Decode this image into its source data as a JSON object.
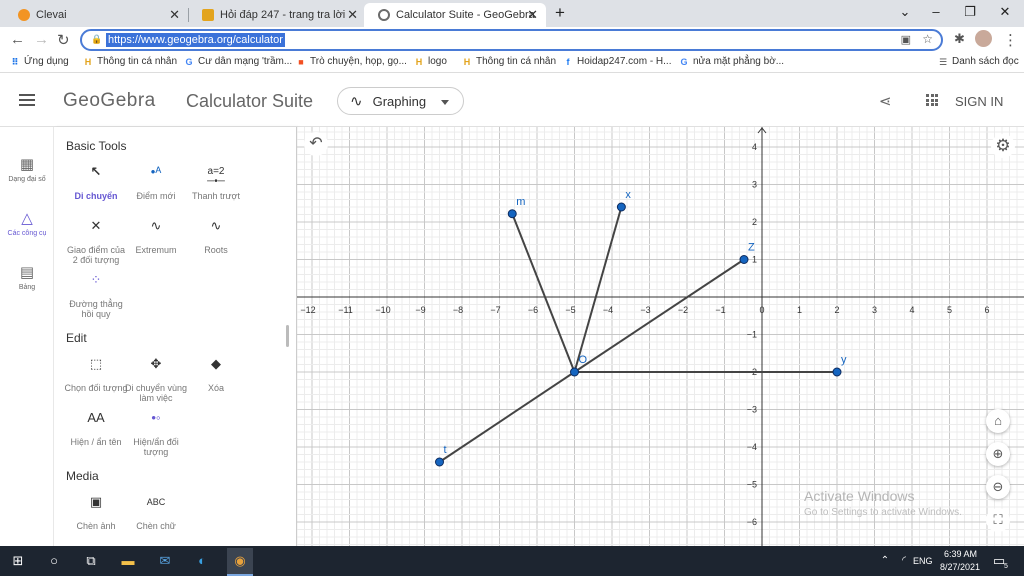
{
  "browser": {
    "tabs": [
      {
        "title": "Clevai",
        "favicon_color": "#f29423"
      },
      {
        "title": "Hỏi đáp 247 - trang tra lời",
        "favicon_color": "#e3a41d"
      },
      {
        "title": "Calculator Suite - GeoGebra",
        "favicon_color": "#6b6b6b"
      }
    ],
    "new_tab": "+",
    "url": "https://www.geogebra.org/calculator",
    "bookmarks": [
      "Ứng dụng",
      "Thông tin cá nhân",
      "Cư dân mạng 'trầm...",
      "Trò chuyện, họp, gọ...",
      "logo",
      "Thông tin cá nhân",
      "Hoidap247.com - H...",
      "nửa mặt phẳng bờ...",
      "Danh sách đọc"
    ]
  },
  "app": {
    "logo": "GeoGebra",
    "suite": "Calculator Suite",
    "app_picker": "Graphing",
    "sign_in": "SIGN IN"
  },
  "rail": [
    {
      "label": "Dạng đại số",
      "icon": "calculator-icon"
    },
    {
      "label": "Các công cụ",
      "icon": "tools-icon"
    },
    {
      "label": "Bảng",
      "icon": "table-icon"
    }
  ],
  "panel": {
    "basic_title": "Basic Tools",
    "basic_tools": [
      {
        "label": "Di chuyển",
        "icon": "move-cursor-icon"
      },
      {
        "label": "Điểm mới",
        "icon": "point-icon"
      },
      {
        "label": "Thanh trượt",
        "icon": "slider-icon"
      },
      {
        "label": "Giao điểm của 2 đối tượng",
        "icon": "intersect-icon"
      },
      {
        "label": "Extremum",
        "icon": "extremum-icon"
      },
      {
        "label": "Roots",
        "icon": "roots-icon"
      },
      {
        "label": "Đường thẳng hồi quy",
        "icon": "regression-icon"
      }
    ],
    "edit_title": "Edit",
    "edit_tools": [
      {
        "label": "Chọn đối tượng",
        "icon": "select-icon"
      },
      {
        "label": "Di chuyển vùng làm việc",
        "icon": "move-view-icon"
      },
      {
        "label": "Xóa",
        "icon": "eraser-icon"
      },
      {
        "label": "Hiện / ẩn tên",
        "icon": "label-toggle-icon"
      },
      {
        "label": "Hiện/ẩn đối tượng",
        "icon": "object-toggle-icon"
      }
    ],
    "media_title": "Media",
    "media_tools": [
      {
        "label": "Chèn ảnh",
        "icon": "image-icon"
      },
      {
        "label": "Chèn chữ",
        "icon": "text-icon"
      }
    ]
  },
  "graph": {
    "x_range": [
      -12.5,
      6.8
    ],
    "y_range": [
      -6.6,
      4.4
    ],
    "x_ticks": [
      -12,
      -11,
      -10,
      -9,
      -8,
      -7,
      -6,
      -5,
      -4,
      -3,
      -2,
      -1,
      0,
      1,
      2,
      3,
      4,
      5,
      6
    ],
    "y_ticks": [
      -6,
      -5,
      -4,
      -3,
      -2,
      -1,
      1,
      2,
      3,
      4
    ],
    "point_color": "#1565c0",
    "line_color": "#444444",
    "points": [
      {
        "name": "O",
        "x": -5.0,
        "y": -2.0
      },
      {
        "name": "m",
        "x": -6.66,
        "y": 2.22
      },
      {
        "name": "x",
        "x": -3.75,
        "y": 2.4
      },
      {
        "name": "Z",
        "x": -0.48,
        "y": 1.0
      },
      {
        "name": "y",
        "x": 2.0,
        "y": -2.0
      },
      {
        "name": "t",
        "x": -8.6,
        "y": -4.4
      }
    ],
    "segments": [
      [
        "O",
        "m"
      ],
      [
        "O",
        "x"
      ],
      [
        "O",
        "Z"
      ],
      [
        "O",
        "y"
      ],
      [
        "O",
        "t"
      ]
    ]
  },
  "watermark": {
    "title": "Activate Windows",
    "subtitle": "Go to Settings to activate Windows."
  },
  "taskbar": {
    "lang": "ENG",
    "time": "6:39 AM",
    "date": "8/27/2021",
    "notif_count": "5"
  }
}
